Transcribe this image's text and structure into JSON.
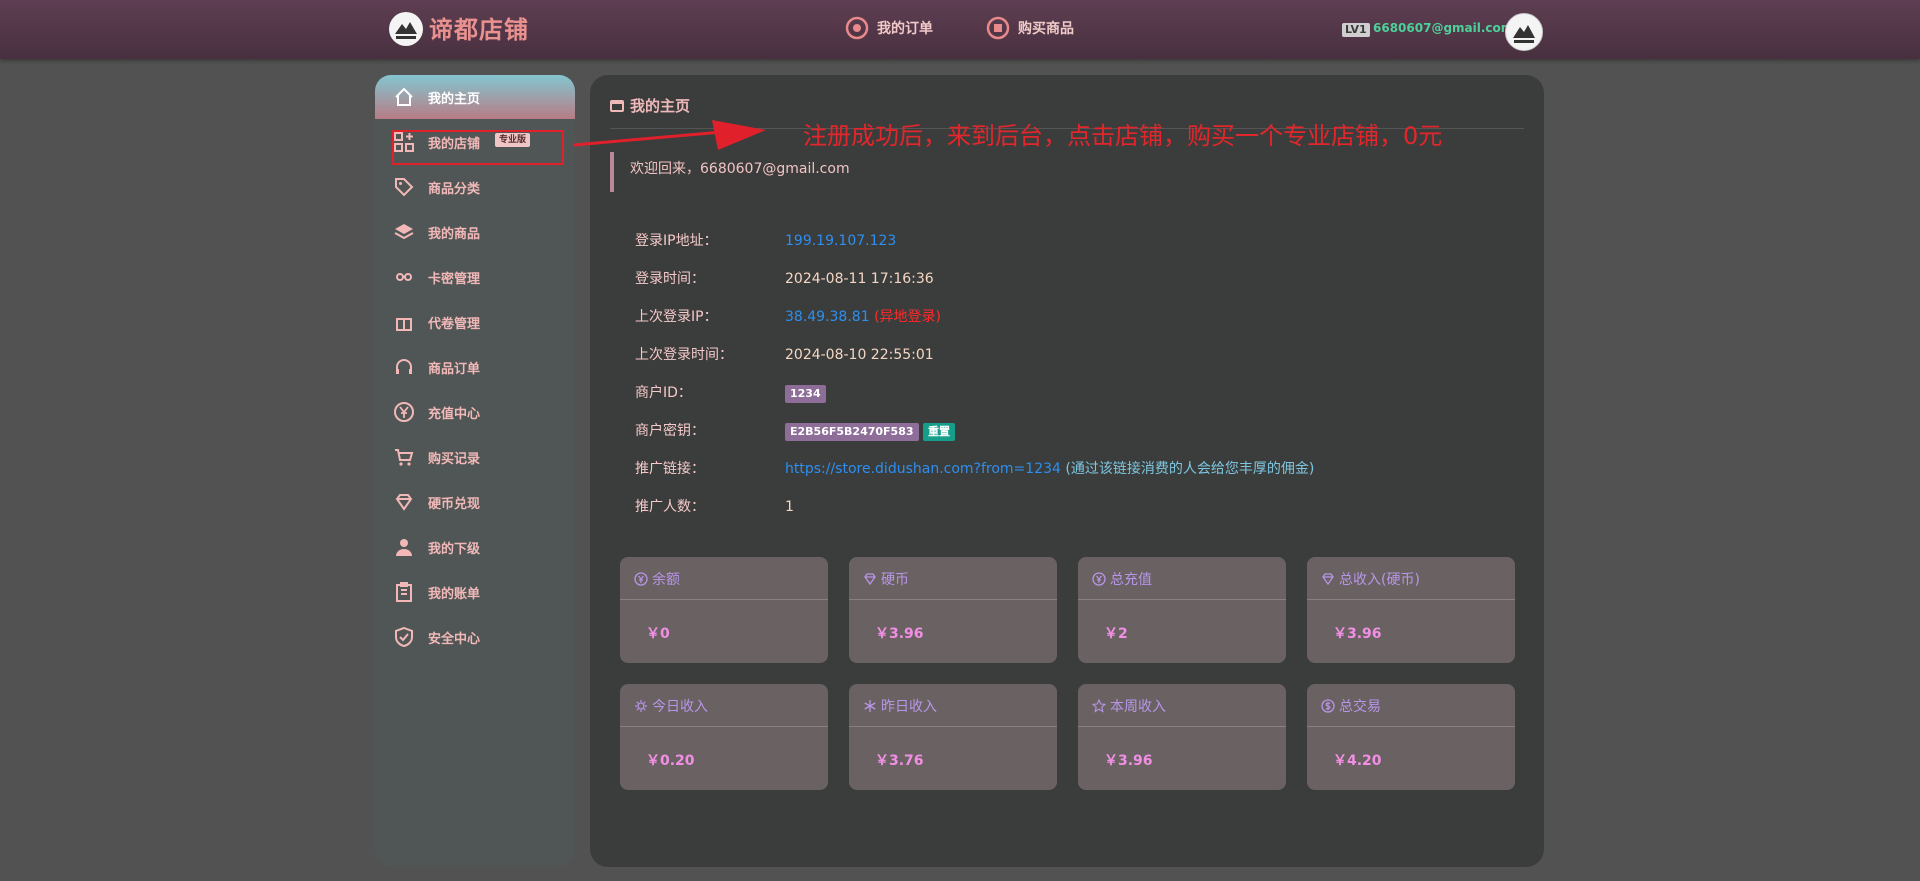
{
  "header": {
    "brand": "谛都店铺",
    "nav": [
      {
        "label": "我的订单",
        "icon": "order-icon"
      },
      {
        "label": "购买商品",
        "icon": "cart-icon"
      }
    ],
    "user_level": "LV1",
    "user_email": "6680607@gmail.com"
  },
  "sidebar": {
    "items": [
      {
        "label": "我的主页",
        "icon": "home-icon",
        "active": true
      },
      {
        "label": "我的店铺",
        "icon": "apps-icon",
        "badge": "专业版"
      },
      {
        "label": "商品分类",
        "icon": "tag-icon"
      },
      {
        "label": "我的商品",
        "icon": "layers-icon"
      },
      {
        "label": "卡密管理",
        "icon": "link-icon"
      },
      {
        "label": "代卷管理",
        "icon": "gift-icon"
      },
      {
        "label": "商品订单",
        "icon": "headset-icon"
      },
      {
        "label": "充值中心",
        "icon": "yen-circle-icon"
      },
      {
        "label": "购买记录",
        "icon": "cart-icon"
      },
      {
        "label": "硬币兑现",
        "icon": "diamond-icon"
      },
      {
        "label": "我的下级",
        "icon": "user-icon"
      },
      {
        "label": "我的账单",
        "icon": "clipboard-icon"
      },
      {
        "label": "安全中心",
        "icon": "shield-check-icon"
      }
    ]
  },
  "main": {
    "title": "我的主页",
    "welcome": "欢迎回来，6680607@gmail.com",
    "info": {
      "login_ip_label": "登录IP地址：",
      "login_ip": "199.19.107.123",
      "login_time_label": "登录时间：",
      "login_time": "2024-08-11 17:16:36",
      "last_ip_label": "上次登录IP：",
      "last_ip": "38.49.38.81",
      "last_ip_note": "(异地登录)",
      "last_time_label": "上次登录时间：",
      "last_time": "2024-08-10 22:55:01",
      "merchant_id_label": "商户ID：",
      "merchant_id": "1234",
      "merchant_key_label": "商户密钥：",
      "merchant_key": "E2B56F5B2470F583",
      "reset_label": "重置",
      "promo_link_label": "推广链接：",
      "promo_link": "https://store.didushan.com?from=1234",
      "promo_note": "(通过该链接消费的人会给您丰厚的佣金)",
      "promo_count_label": "推广人数：",
      "promo_count": "1"
    },
    "cards": [
      {
        "title": "余额",
        "icon": "yen-circle-icon",
        "value": "￥0"
      },
      {
        "title": "硬币",
        "icon": "diamond-icon",
        "value": "￥3.96"
      },
      {
        "title": "总充值",
        "icon": "yen-circle-icon",
        "value": "￥2"
      },
      {
        "title": "总收入(硬币)",
        "icon": "diamond-icon",
        "value": "￥3.96"
      },
      {
        "title": "今日收入",
        "icon": "sun-icon",
        "value": "￥0.20"
      },
      {
        "title": "昨日收入",
        "icon": "snowflake-icon",
        "value": "￥3.76"
      },
      {
        "title": "本周收入",
        "icon": "star-icon",
        "value": "￥3.96"
      },
      {
        "title": "总交易",
        "icon": "dollar-circle-icon",
        "value": "￥4.20"
      }
    ]
  },
  "annotation": {
    "text": "注册成功后，来到后台，点击店铺，购买一个专业店铺，0元",
    "color": "#e3262b"
  },
  "colors": {
    "accent_pink": "#f2b8b8",
    "link_blue": "#2d8ff0",
    "email_green": "#4dd19a",
    "card_value": "#f28fe4",
    "card_title": "#b895e8"
  }
}
